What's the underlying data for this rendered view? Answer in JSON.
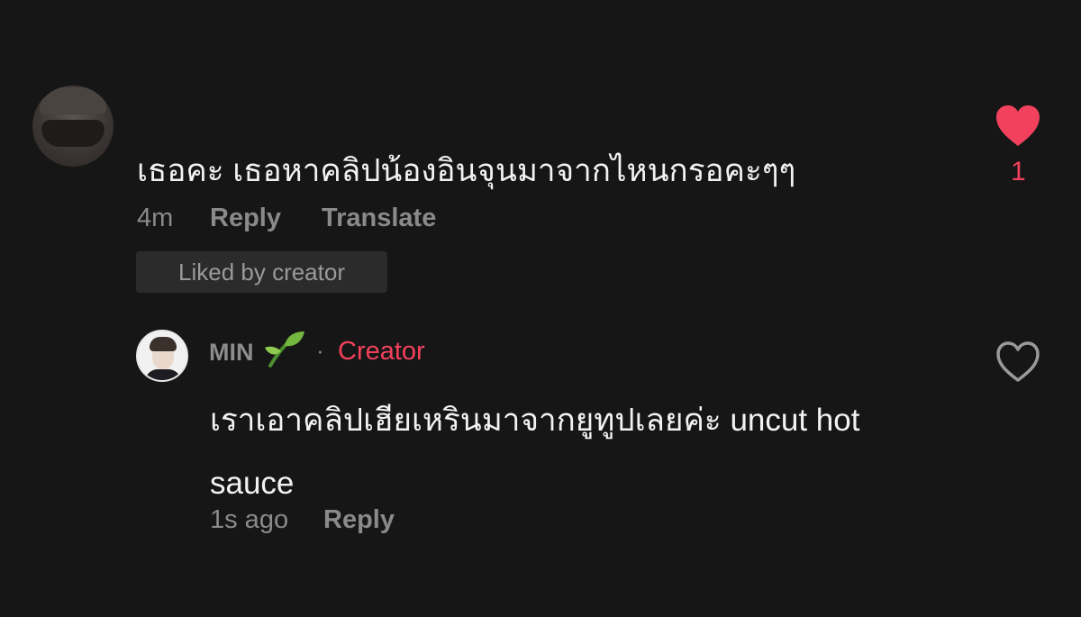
{
  "comment": {
    "text": "เธอคะ เธอหาคลิปน้องอินจุนมาจากไหนกรอคะๆๆ",
    "time": "4m",
    "reply_label": "Reply",
    "translate_label": "Translate",
    "liked_badge": "Liked by creator",
    "like_count": "1",
    "avatar_icon": "user-avatar-masked"
  },
  "reply": {
    "username": "MIN",
    "username_emoji_icon": "seedling-icon",
    "separator": "·",
    "creator_label": "Creator",
    "text": "เราเอาคลิปเฮียเหรินมาจากยูทูปเลยค่ะ uncut hot sauce",
    "time": "1s ago",
    "reply_label": "Reply",
    "avatar_icon": "user-avatar-creator"
  },
  "colors": {
    "background": "#161616",
    "accent": "#f2415c",
    "muted_text": "#8a8a8a",
    "primary_text": "#f2f2f2",
    "badge_bg": "#2b2b2b"
  }
}
